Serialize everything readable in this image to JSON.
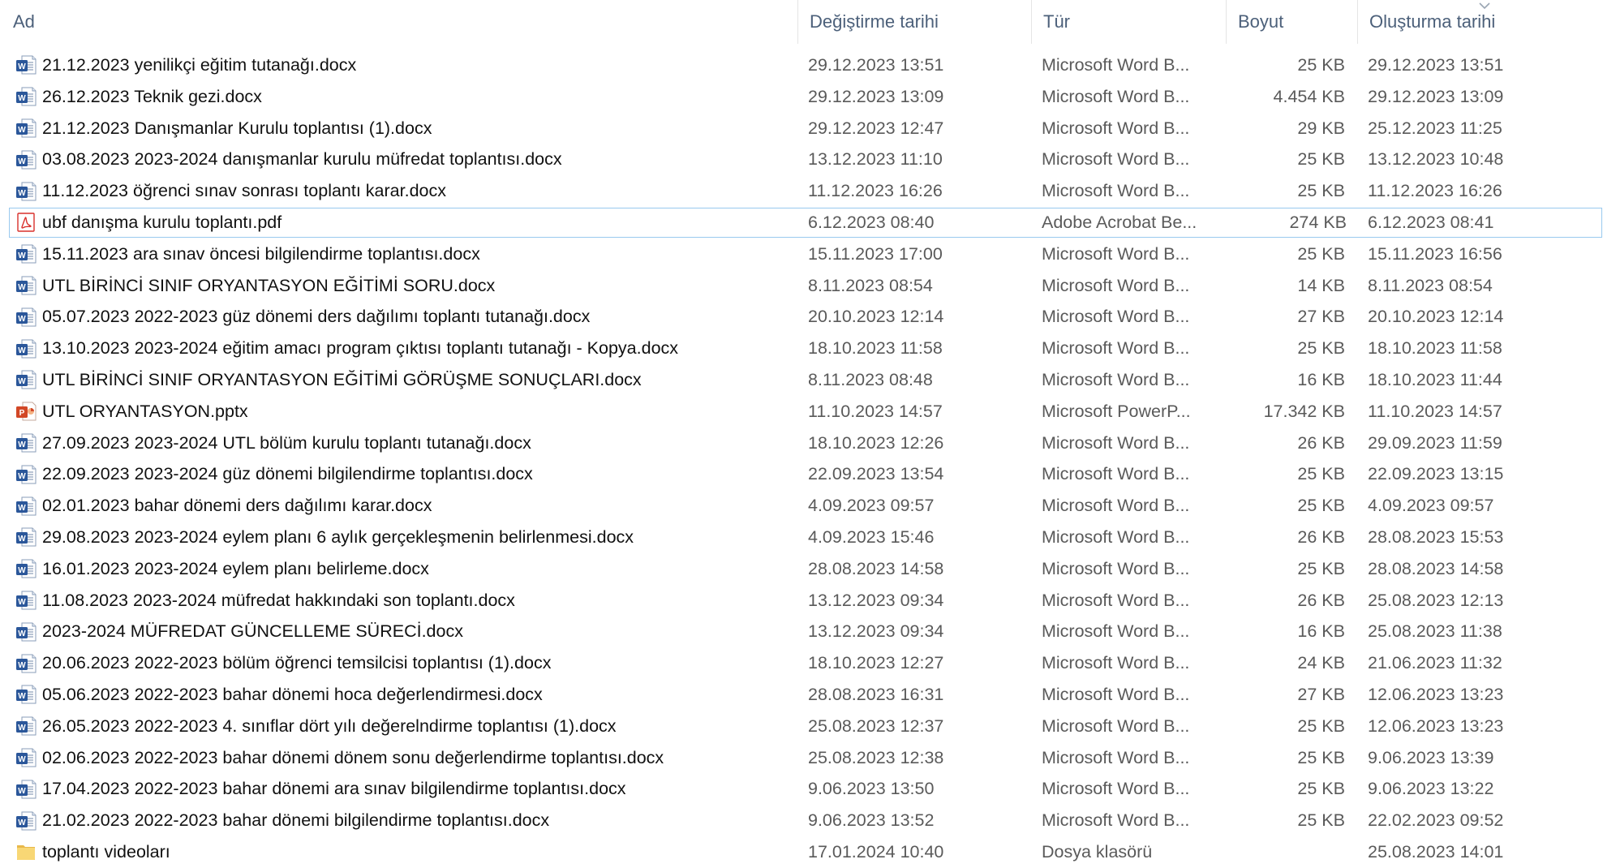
{
  "columns": {
    "name": "Ad",
    "modified": "Değiştirme tarihi",
    "type": "Tür",
    "size": "Boyut",
    "created": "Oluşturma tarihi"
  },
  "sort": {
    "column": "created",
    "direction": "descending",
    "icon": "chevron-down-icon"
  },
  "colors": {
    "header_text": "#4c607a",
    "selection_outline": "#99c9ef",
    "word_blue": "#2b579a",
    "pdf_red": "#d9302c",
    "ppt_orange": "#d24726",
    "folder_yellow": "#f8d775"
  },
  "files": [
    {
      "name": "21.12.2023  yenilikçi eğitim tutanağı.docx",
      "modified": "29.12.2023 13:51",
      "type": "Microsoft Word B...",
      "size": "25 KB",
      "created": "29.12.2023 13:51",
      "icon": "word-doc-icon"
    },
    {
      "name": "26.12.2023 Teknik gezi.docx",
      "modified": "29.12.2023 13:09",
      "type": "Microsoft Word B...",
      "size": "4.454 KB",
      "created": "29.12.2023 13:09",
      "icon": "word-doc-icon"
    },
    {
      "name": "21.12.2023 Danışmanlar Kurulu toplantısı (1).docx",
      "modified": "29.12.2023 12:47",
      "type": "Microsoft Word B...",
      "size": "29 KB",
      "created": "25.12.2023 11:25",
      "icon": "word-doc-icon"
    },
    {
      "name": "03.08.2023 2023-2024 danışmanlar kurulu  müfredat toplantısı.docx",
      "modified": "13.12.2023 11:10",
      "type": "Microsoft Word B...",
      "size": "25 KB",
      "created": "13.12.2023 10:48",
      "icon": "word-doc-icon"
    },
    {
      "name": "11.12.2023 öğrenci sınav sonrası toplantı karar.docx",
      "modified": "11.12.2023 16:26",
      "type": "Microsoft Word B...",
      "size": "25 KB",
      "created": "11.12.2023 16:26",
      "icon": "word-doc-icon"
    },
    {
      "name": "ubf danışma kurulu toplantı.pdf",
      "modified": "6.12.2023 08:40",
      "type": "Adobe Acrobat Be...",
      "size": "274 KB",
      "created": "6.12.2023 08:41",
      "icon": "pdf-file-icon",
      "focused": true
    },
    {
      "name": "15.11.2023 ara sınav öncesi bilgilendirme toplantısı.docx",
      "modified": "15.11.2023 17:00",
      "type": "Microsoft Word B...",
      "size": "25 KB",
      "created": "15.11.2023 16:56",
      "icon": "word-doc-icon"
    },
    {
      "name": "UTL BİRİNCİ SINIF ORYANTASYON EĞİTİMİ SORU.docx",
      "modified": "8.11.2023 08:54",
      "type": "Microsoft Word B...",
      "size": "14 KB",
      "created": "8.11.2023 08:54",
      "icon": "word-doc-icon"
    },
    {
      "name": "05.07.2023 2022-2023 güz dönemi ders dağılımı  toplantı tutanağı.docx",
      "modified": "20.10.2023 12:14",
      "type": "Microsoft Word B...",
      "size": "27 KB",
      "created": "20.10.2023 12:14",
      "icon": "word-doc-icon"
    },
    {
      "name": "13.10.2023 2023-2024 eğitim amacı program çıktısı toplantı tutanağı - Kopya.docx",
      "modified": "18.10.2023 11:58",
      "type": "Microsoft Word B...",
      "size": "25 KB",
      "created": "18.10.2023 11:58",
      "icon": "word-doc-icon"
    },
    {
      "name": "UTL BİRİNCİ SINIF ORYANTASYON EĞİTİMİ GÖRÜŞME SONUÇLARI.docx",
      "modified": "8.11.2023 08:48",
      "type": "Microsoft Word B...",
      "size": "16 KB",
      "created": "18.10.2023 11:44",
      "icon": "word-doc-icon"
    },
    {
      "name": "UTL ORYANTASYON.pptx",
      "modified": "11.10.2023 14:57",
      "type": "Microsoft PowerP...",
      "size": "17.342 KB",
      "created": "11.10.2023 14:57",
      "icon": "powerpoint-file-icon"
    },
    {
      "name": "27.09.2023 2023-2024 UTL bölüm kurulu toplantı tutanağı.docx",
      "modified": "18.10.2023 12:26",
      "type": "Microsoft Word B...",
      "size": "26 KB",
      "created": "29.09.2023 11:59",
      "icon": "word-doc-icon"
    },
    {
      "name": "22.09.2023 2023-2024 güz dönemi bilgilendirme toplantısı.docx",
      "modified": "22.09.2023 13:54",
      "type": "Microsoft Word B...",
      "size": "25 KB",
      "created": "22.09.2023 13:15",
      "icon": "word-doc-icon"
    },
    {
      "name": "02.01.2023 bahar dönemi ders dağılımı karar.docx",
      "modified": "4.09.2023 09:57",
      "type": "Microsoft Word B...",
      "size": "25 KB",
      "created": "4.09.2023 09:57",
      "icon": "word-doc-icon"
    },
    {
      "name": "29.08.2023  2023-2024 eylem planı  6 aylık gerçekleşmenin belirlenmesi.docx",
      "modified": "4.09.2023 15:46",
      "type": "Microsoft Word B...",
      "size": "26 KB",
      "created": "28.08.2023 15:53",
      "icon": "word-doc-icon"
    },
    {
      "name": "16.01.2023  2023-2024 eylem planı belirleme.docx",
      "modified": "28.08.2023 14:58",
      "type": "Microsoft Word B...",
      "size": "25 KB",
      "created": "28.08.2023 14:58",
      "icon": "word-doc-icon"
    },
    {
      "name": "11.08.2023 2023-2024 müfredat hakkındaki son toplantı.docx",
      "modified": "13.12.2023 09:34",
      "type": "Microsoft Word B...",
      "size": "26 KB",
      "created": "25.08.2023 12:13",
      "icon": "word-doc-icon"
    },
    {
      "name": "2023-2024 MÜFREDAT GÜNCELLEME SÜRECİ.docx",
      "modified": "13.12.2023 09:34",
      "type": "Microsoft Word B...",
      "size": "16 KB",
      "created": "25.08.2023 11:38",
      "icon": "word-doc-icon"
    },
    {
      "name": "20.06.2023 2022-2023 bölüm öğrenci temsilcisi  toplantısı (1).docx",
      "modified": "18.10.2023 12:27",
      "type": "Microsoft Word B...",
      "size": "24 KB",
      "created": "21.06.2023 11:32",
      "icon": "word-doc-icon"
    },
    {
      "name": "05.06.2023  2022-2023 bahar dönemi  hoca değerlendirmesi.docx",
      "modified": "28.08.2023 16:31",
      "type": "Microsoft Word B...",
      "size": "27 KB",
      "created": "12.06.2023 13:23",
      "icon": "word-doc-icon"
    },
    {
      "name": "26.05.2023 2022-2023 4. sınıflar dört yılı değerelndirme toplantısı (1).docx",
      "modified": "25.08.2023 12:37",
      "type": "Microsoft Word B...",
      "size": "25 KB",
      "created": "12.06.2023 13:23",
      "icon": "word-doc-icon"
    },
    {
      "name": "02.06.2023 2022-2023 bahar dönemi  dönem sonu değerlendirme toplantısı.docx",
      "modified": "25.08.2023 12:38",
      "type": "Microsoft Word B...",
      "size": "25 KB",
      "created": "9.06.2023 13:39",
      "icon": "word-doc-icon"
    },
    {
      "name": "17.04.2023 2022-2023 bahar dönemi  ara sınav bilgilendirme toplantısı.docx",
      "modified": "9.06.2023 13:50",
      "type": "Microsoft Word B...",
      "size": "25 KB",
      "created": "9.06.2023 13:22",
      "icon": "word-doc-icon"
    },
    {
      "name": "21.02.2023 2022-2023 bahar dönemi bilgilendirme toplantısı.docx",
      "modified": "9.06.2023 13:52",
      "type": "Microsoft Word B...",
      "size": "25 KB",
      "created": "22.02.2023 09:52",
      "icon": "word-doc-icon"
    },
    {
      "name": "toplantı videoları",
      "modified": "17.01.2024 10:40",
      "type": "Dosya klasörü",
      "size": "",
      "created": "25.08.2023 14:01",
      "icon": "folder-icon"
    }
  ]
}
